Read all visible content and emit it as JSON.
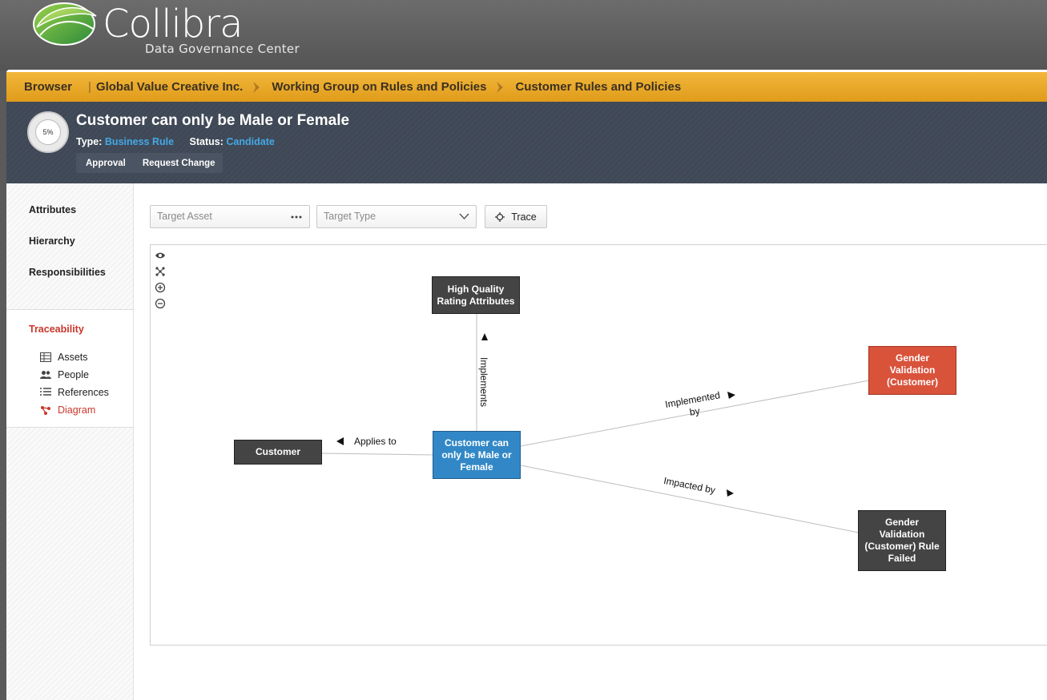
{
  "brand": {
    "name": "Collibra",
    "subtitle": "Data Governance Center"
  },
  "breadcrumb": {
    "root": "Browser",
    "items": [
      "Global Value Creative Inc.",
      "Working Group on Rules and Policies",
      "Customer Rules and Policies"
    ]
  },
  "asset": {
    "progress": "5%",
    "title": "Customer can only be Male or Female",
    "type_label": "Type:",
    "type_value": "Business Rule",
    "status_label": "Status:",
    "status_value": "Candidate",
    "actions": [
      "Approval",
      "Request Change"
    ]
  },
  "sidebar": {
    "sections": [
      "Attributes",
      "Hierarchy",
      "Responsibilities"
    ],
    "traceability": {
      "title": "Traceability",
      "items": [
        {
          "label": "Assets",
          "icon": "table-icon"
        },
        {
          "label": "People",
          "icon": "people-icon"
        },
        {
          "label": "References",
          "icon": "list-icon"
        },
        {
          "label": "Diagram",
          "icon": "diagram-icon"
        }
      ]
    }
  },
  "filters": {
    "target_asset_placeholder": "Target Asset",
    "target_type_placeholder": "Target Type",
    "trace_label": "Trace"
  },
  "diagram": {
    "tools": [
      "eye-icon",
      "layout-icon",
      "zoom-in-icon",
      "zoom-out-icon"
    ],
    "nodes": {
      "center": "Customer can only be Male or Female",
      "top": "High Quality Rating Attributes",
      "left": "Customer",
      "right_top": "Gender Validation (Customer)",
      "right_bottom": "Gender Validation (Customer) Rule Failed"
    },
    "edges": {
      "implements": "Implements",
      "applies_to": "Applies to",
      "implemented_by": "Implemented by",
      "impacted_by": "Impacted by"
    },
    "colors": {
      "focus": "#3288c6",
      "highlight": "#d9533b",
      "default": "#444444"
    }
  }
}
